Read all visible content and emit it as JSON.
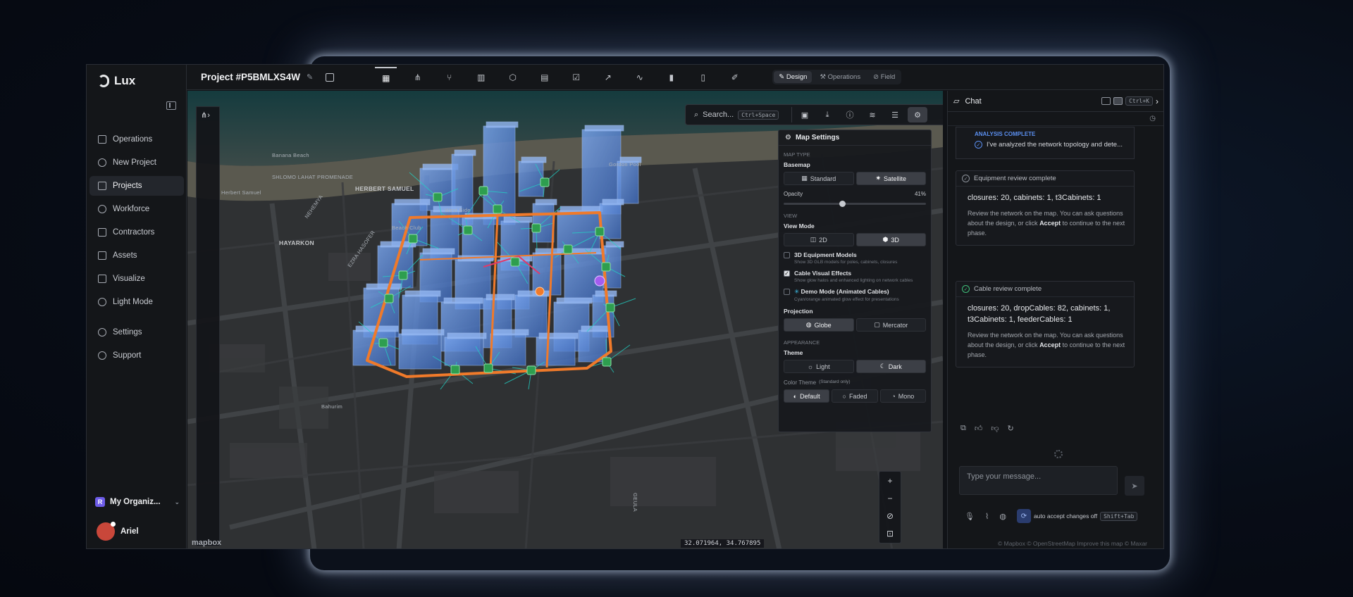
{
  "app": {
    "brand": "Lux",
    "project_title": "Project #P5BMLXS4W"
  },
  "sidebar": {
    "items": [
      {
        "label": "Operations",
        "icon": "grid-icon",
        "active": false
      },
      {
        "label": "New Project",
        "icon": "plus-circle-icon",
        "active": false
      },
      {
        "label": "Projects",
        "icon": "folder-icon",
        "active": true
      },
      {
        "label": "Workforce",
        "icon": "user-icon",
        "active": false
      },
      {
        "label": "Contractors",
        "icon": "briefcase-icon",
        "active": false
      },
      {
        "label": "Assets",
        "icon": "building-icon",
        "active": false
      },
      {
        "label": "Visualize",
        "icon": "map-icon",
        "active": false
      },
      {
        "label": "Light Mode",
        "icon": "sun-icon",
        "active": false
      }
    ],
    "bottom_items": [
      {
        "label": "Settings",
        "icon": "gear-icon"
      },
      {
        "label": "Support",
        "icon": "help-circle-icon"
      }
    ],
    "org": {
      "badge": "R",
      "name": "My Organiz..."
    },
    "user": {
      "name": "Ariel"
    }
  },
  "topbar": {
    "tools": [
      "map-icon",
      "network-icon",
      "branch-icon",
      "building-icon",
      "box-icon",
      "clipboard-icon",
      "clipboard-check-icon",
      "trend-icon",
      "pulse-icon",
      "bar-chart-icon",
      "document-icon",
      "ruler-icon"
    ],
    "modes": [
      {
        "label": "Design",
        "active": true
      },
      {
        "label": "Operations",
        "active": false
      },
      {
        "label": "Field",
        "active": false
      }
    ]
  },
  "map": {
    "search_label": "Search...",
    "search_shortcut": "Ctrl+Space",
    "labels": [
      "Banana Beach",
      "SHLOMO LAHAT PROMENADE",
      "HERBERT SAMUEL",
      "Herbert Samuel",
      "HAYARKON",
      "EZRA HASOFER",
      "NEHEMYA",
      "West Side",
      "Beach Club",
      "Gordon Pool",
      "Bahurim",
      "GEULA"
    ],
    "coords": "32.071964, 34.767895",
    "attribution_logo": "mapbox",
    "attribution": "© Mapbox © OpenStreetMap Improve this map © Maxar"
  },
  "settings": {
    "title": "Map Settings",
    "map_type_caption": "MAP TYPE",
    "basemap_label": "Basemap",
    "basemap_options": [
      {
        "label": "Standard",
        "active": false
      },
      {
        "label": "Satellite",
        "active": true
      }
    ],
    "opacity_label": "Opacity",
    "opacity_value": "41%",
    "opacity_fraction": 0.41,
    "view_caption": "VIEW",
    "view_mode_label": "View Mode",
    "view_options": [
      {
        "label": "2D",
        "active": false
      },
      {
        "label": "3D",
        "active": true
      }
    ],
    "checks": [
      {
        "label": "3D Equipment Models",
        "desc": "Show 3D GLB models for poles, cabinets, closures",
        "checked": false
      },
      {
        "label": "Cable Visual Effects",
        "desc": "Show glow halos and enhanced lighting on network cables",
        "checked": true
      },
      {
        "label": "Demo Mode (Animated Cables)",
        "desc": "Cyan/orange animated glow effect for presentations",
        "checked": false
      }
    ],
    "projection_label": "Projection",
    "projection_options": [
      {
        "label": "Globe",
        "active": true
      },
      {
        "label": "Mercator",
        "active": false
      }
    ],
    "appearance_caption": "APPEARANCE",
    "theme_label": "Theme",
    "theme_options": [
      {
        "label": "Light",
        "active": false
      },
      {
        "label": "Dark",
        "active": true
      }
    ],
    "color_theme_label": "Color Theme",
    "color_theme_note": "(Standard only)",
    "color_theme_options": [
      {
        "label": "Default",
        "active": true
      },
      {
        "label": "Faded",
        "active": false
      },
      {
        "label": "Mono",
        "active": false
      }
    ]
  },
  "chat": {
    "title": "Chat",
    "shortcut": "Ctrl+K",
    "analysis_caption": "ANALYSIS COMPLETE",
    "analysis_text": "I've analyzed the network topology and dete...",
    "cards": [
      {
        "head": "Equipment review complete",
        "title": "closures: 20, cabinets: 1, t3Cabinets: 1",
        "text_a": "Review the network on the map. You can ask questions about the design, or click ",
        "accept": "Accept",
        "text_b": " to continue to the next phase."
      },
      {
        "head": "Cable review complete",
        "title": "closures: 20, dropCables: 82, cabinets: 1, t3Cabinets: 1, feederCables: 1",
        "text_a": "Review the network on the map. You can ask questions about the design, or click ",
        "accept": "Accept",
        "text_b": " to continue to the next phase."
      }
    ],
    "input_placeholder": "Type your message...",
    "auto_accept_label": "auto accept changes off",
    "auto_accept_shortcut": "Shift+Tab"
  },
  "colors": {
    "accent": "#5b8ff0",
    "cable": "#f07a2a",
    "drop": "#22d3c5",
    "building": "#5a8ad8",
    "node": "#2e9e4f"
  }
}
